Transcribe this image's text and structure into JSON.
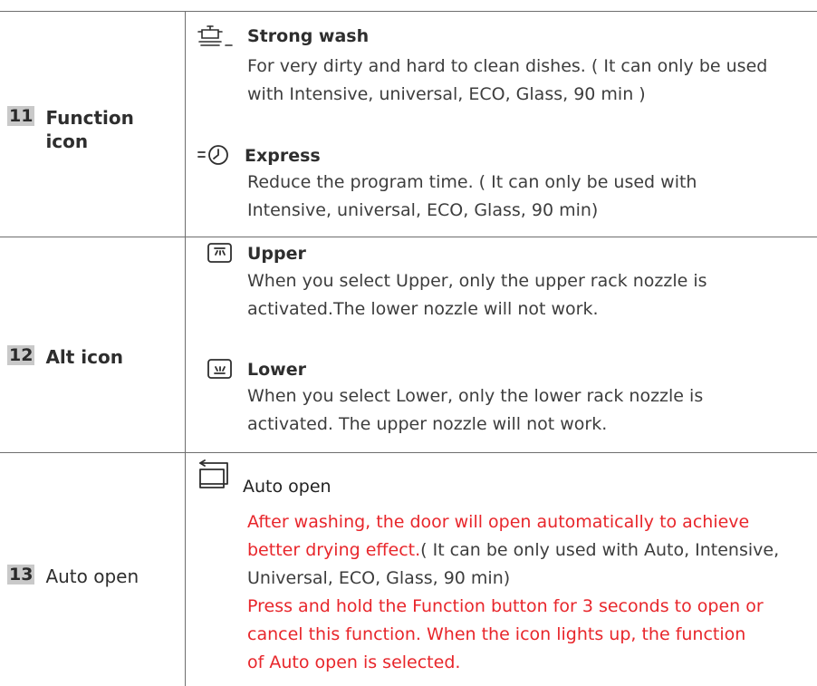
{
  "rows": [
    {
      "number": "11",
      "label_line1": "Function",
      "label_line2": "icon",
      "features": [
        {
          "icon": "strong-wash-icon",
          "title": "Strong wash",
          "desc_line1": "For very dirty and hard to clean dishes. ( It can only be used",
          "desc_line2": "with Intensive, universal, ECO, Glass, 90 min )"
        },
        {
          "icon": "express-clock-icon",
          "title": "Express",
          "desc_line1": "Reduce the program time. ( It can only be used with",
          "desc_line2": "Intensive, universal, ECO, Glass, 90 min)"
        }
      ]
    },
    {
      "number": "12",
      "label": "Alt icon",
      "features": [
        {
          "icon": "upper-rack-icon",
          "title": "Upper",
          "desc_line1": "When you select Upper, only the upper rack nozzle is",
          "desc_line2": "activated.The lower nozzle will not work."
        },
        {
          "icon": "lower-rack-icon",
          "title": "Lower",
          "desc_line1": "When you select Lower, only the lower rack nozzle is",
          "desc_line2": "activated. The upper nozzle will not work."
        }
      ]
    },
    {
      "number": "13",
      "label": "Auto open",
      "features": [
        {
          "icon": "auto-open-icon",
          "title": "Auto open",
          "desc_red_line1": "After washing, the door will open automatically to achieve",
          "desc_red_line2a": "better drying effect.",
          "desc_line2b": "( It can be only used with Auto, Intensive,",
          "desc_line3": "Universal, ECO, Glass, 90 min)",
          "desc_red_line4": "Press and hold the Function button for 3 seconds to open or",
          "desc_red_line5": "cancel this function. When the icon lights up, the function",
          "desc_red_line6": "of Auto open is selected."
        }
      ]
    }
  ],
  "colors": {
    "text": "#3d3d3d",
    "highlight": "#e8262b",
    "number_bg": "#c9c9c9",
    "rule": "#6e6e6e"
  }
}
